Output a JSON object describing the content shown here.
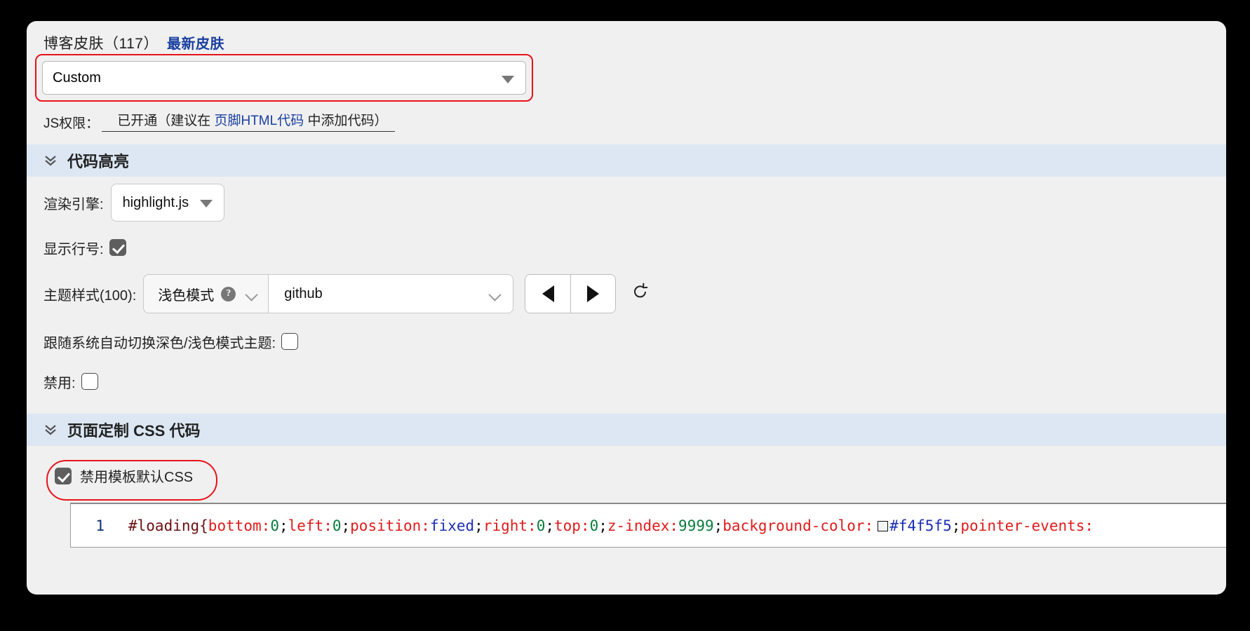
{
  "skin": {
    "title": "博客皮肤（117）",
    "latest_link": "最新皮肤",
    "selected_skin": "Custom",
    "js_permission_label": "JS权限：",
    "js_permission_pre": "已开通（建议在",
    "js_permission_link": "页脚HTML代码",
    "js_permission_post": "中添加代码）"
  },
  "code_highlight": {
    "section_title": "代码高亮",
    "engine_label": "渲染引擎:",
    "engine_value": "highlight.js",
    "line_number_label": "显示行号:",
    "line_number_checked": true,
    "theme_label": "主题样式(100):",
    "theme_mode": "浅色模式",
    "theme_help": "?",
    "theme_name": "github",
    "prev_button": "◀",
    "next_button": "▶",
    "reset_button": "↺",
    "auto_switch_label": "跟随系统自动切换深色/浅色模式主题:",
    "auto_switch_checked": false,
    "disable_label": "禁用:",
    "disable_checked": false
  },
  "custom_css": {
    "section_title": "页面定制 CSS 代码",
    "disable_default_css_label": "禁用模板默认CSS",
    "disable_default_css_checked": true,
    "editor": {
      "line_number": "1",
      "tokens": [
        {
          "text": "#loading{",
          "type": "sel"
        },
        {
          "text": "bottom:",
          "type": "prop"
        },
        {
          "text": "0",
          "type": "num"
        },
        {
          "text": ";",
          "type": "punc"
        },
        {
          "text": "left:",
          "type": "prop"
        },
        {
          "text": "0",
          "type": "num"
        },
        {
          "text": ";",
          "type": "punc"
        },
        {
          "text": "position:",
          "type": "prop"
        },
        {
          "text": "fixed",
          "type": "val"
        },
        {
          "text": ";",
          "type": "punc"
        },
        {
          "text": "right:",
          "type": "prop"
        },
        {
          "text": "0",
          "type": "num"
        },
        {
          "text": ";",
          "type": "punc"
        },
        {
          "text": "top:",
          "type": "prop"
        },
        {
          "text": "0",
          "type": "num"
        },
        {
          "text": ";",
          "type": "punc"
        },
        {
          "text": "z-index:",
          "type": "prop"
        },
        {
          "text": "9999",
          "type": "num"
        },
        {
          "text": ";",
          "type": "punc"
        },
        {
          "text": "background-color:",
          "type": "prop"
        },
        {
          "text": "",
          "type": "swatch",
          "color": "#f4f5f5"
        },
        {
          "text": "#f4f5f5",
          "type": "val"
        },
        {
          "text": ";",
          "type": "punc"
        },
        {
          "text": "pointer-events:",
          "type": "prop"
        }
      ],
      "raw": "#loading{bottom:0;left:0;position:fixed;right:0;top:0;z-index:9999;background-color:#f4f5f5;pointer-events:"
    }
  },
  "colors": {
    "highlight_ring": "#e8131a",
    "section_header_bg": "#dce7f3",
    "page_bg": "#f0f0f0",
    "link": "#1a3fa0"
  }
}
